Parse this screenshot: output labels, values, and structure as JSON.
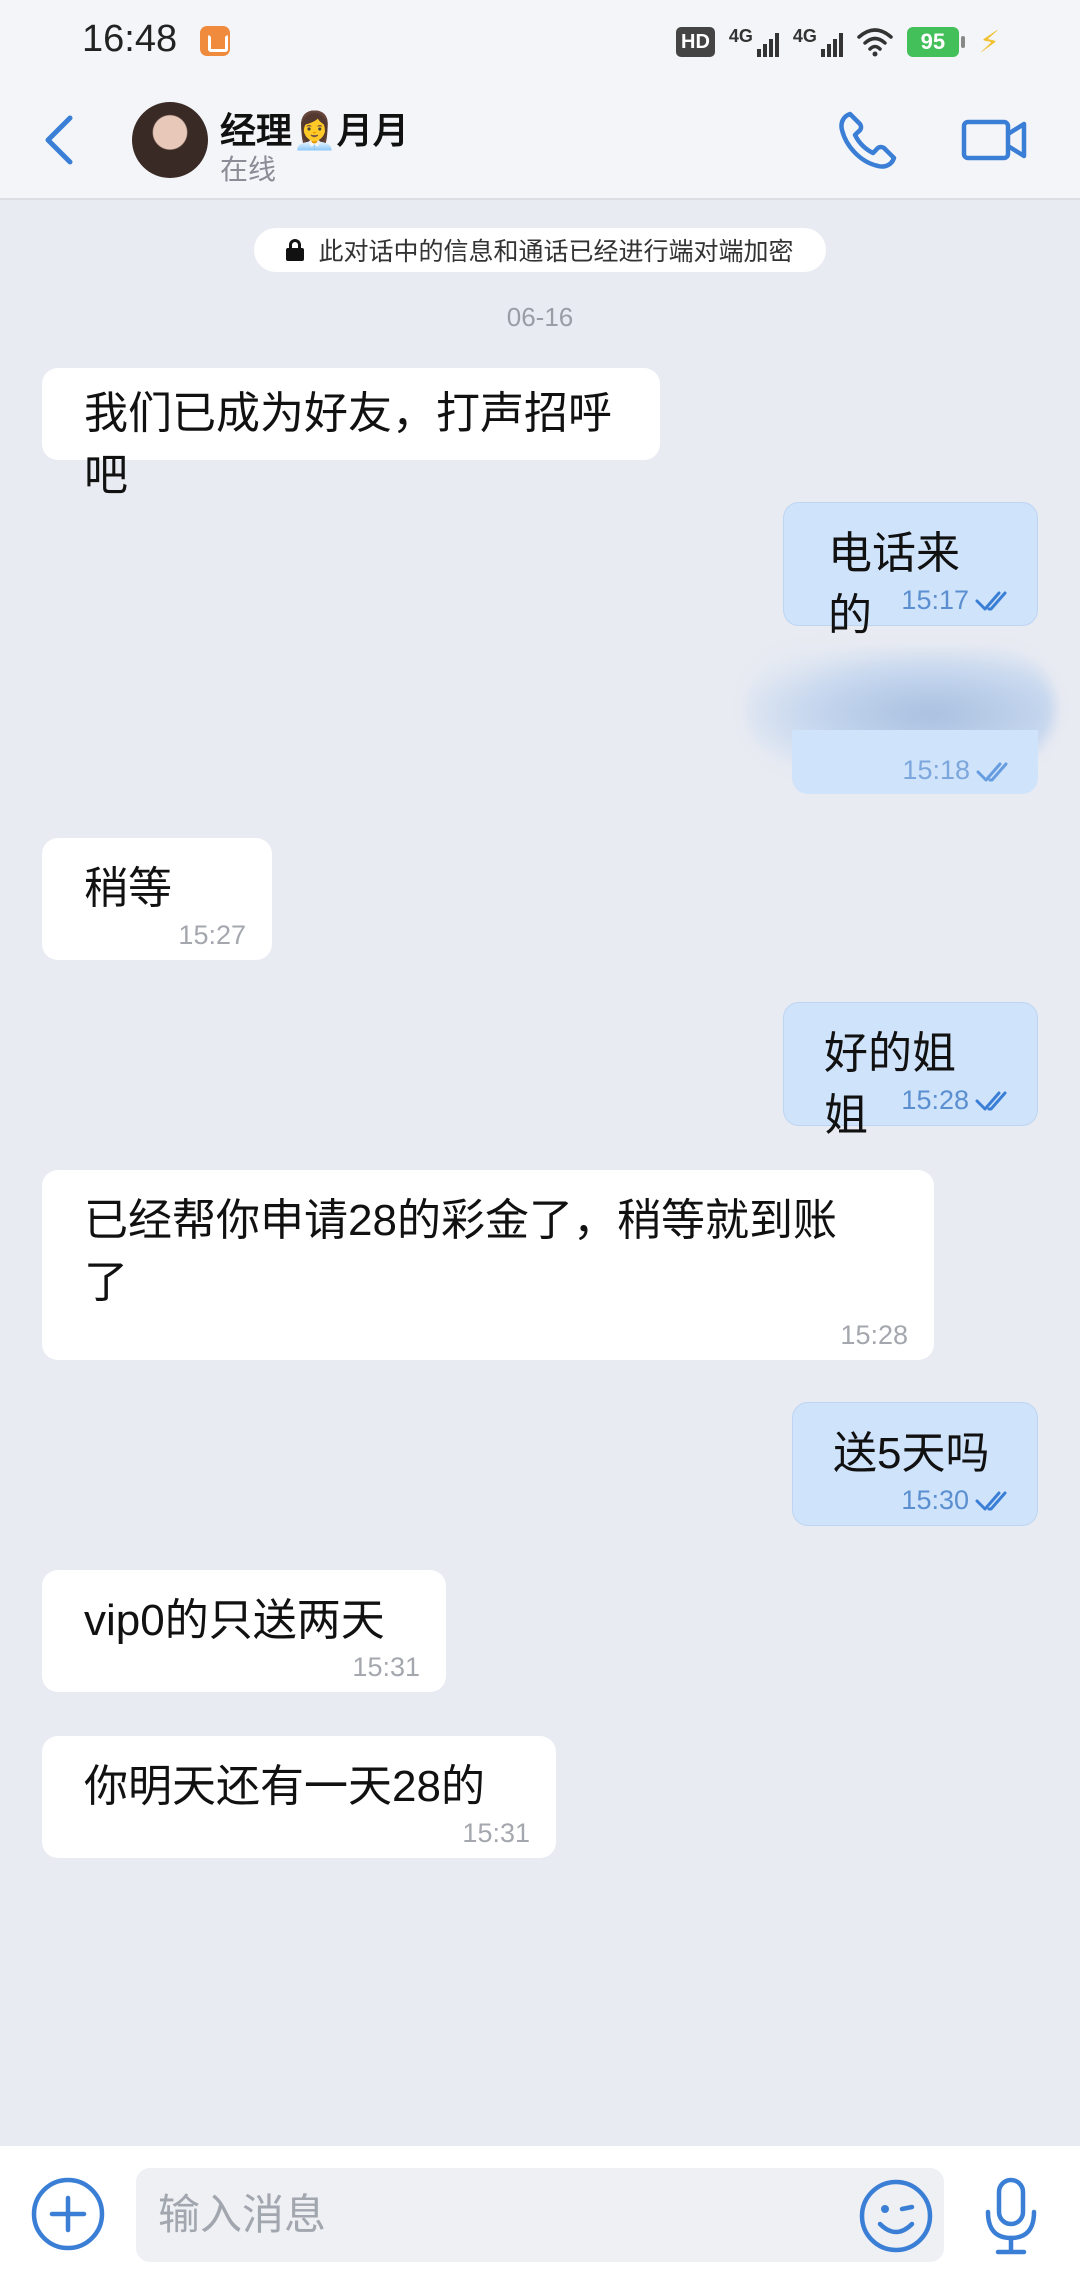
{
  "status_bar": {
    "time": "16:48",
    "network_labels": [
      "4G",
      "4G"
    ],
    "hd_label": "HD",
    "battery": "95"
  },
  "header": {
    "contact_name": "经理👩‍💼月月",
    "contact_status": "在线"
  },
  "encryption_notice": "此对话中的信息和通话已经进行端对端加密",
  "date_separator": "06-16",
  "messages": [
    {
      "dir": "in",
      "text": "我们已成为好友，打声招呼吧",
      "time": ""
    },
    {
      "dir": "out",
      "text": "电话来的",
      "time": "15:17"
    },
    {
      "dir": "out",
      "text": "",
      "time": "15:18",
      "blurred": true
    },
    {
      "dir": "in",
      "text": "稍等",
      "time": "15:27"
    },
    {
      "dir": "out",
      "text": "好的姐姐",
      "time": "15:28"
    },
    {
      "dir": "in",
      "text": "已经帮你申请28的彩金了，稍等就到账了",
      "time": "15:28"
    },
    {
      "dir": "out",
      "text": "送5天吗",
      "time": "15:30"
    },
    {
      "dir": "in",
      "text": "vip0的只送两天",
      "time": "15:31"
    },
    {
      "dir": "in",
      "text": "你明天还有一天28的",
      "time": "15:31"
    }
  ],
  "input": {
    "placeholder": "输入消息"
  },
  "colors": {
    "accent": "#3a7fd5",
    "outgoing_bubble": "#cfe3fb",
    "incoming_bubble": "#ffffff",
    "background": "#e9ebf2"
  }
}
